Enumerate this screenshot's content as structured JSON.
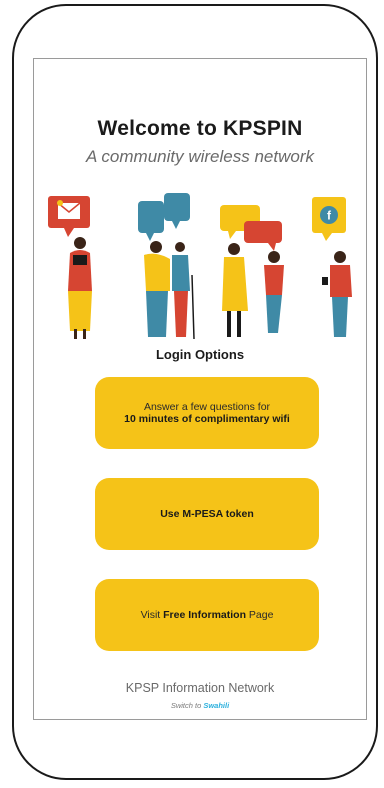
{
  "header": {
    "title": "Welcome to KPSPIN",
    "subtitle": "A community wireless network"
  },
  "login": {
    "heading": "Login Options",
    "options": [
      {
        "line1": "Answer a few questions for",
        "line2": "10 minutes of complimentary wifi"
      },
      {
        "label": "Use M-PESA token"
      },
      {
        "prefix": "Visit ",
        "bold": "Free Information",
        "suffix": " Page"
      }
    ]
  },
  "footer": {
    "network": "KPSP Information Network",
    "switch_prefix": "Switch to ",
    "switch_language": "Swahili"
  },
  "colors": {
    "button": "#f5c318",
    "link": "#2bb0dd",
    "bubble_red": "#d64532",
    "bubble_blue": "#3f8aa6",
    "bubble_yellow": "#f5c318"
  },
  "icons": [
    "envelope-icon",
    "facebook-icon"
  ]
}
